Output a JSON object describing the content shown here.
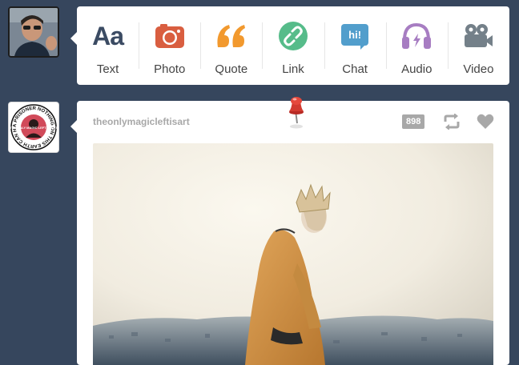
{
  "post_types": [
    {
      "label": "Text",
      "icon": "text-icon",
      "glyph": "Aa",
      "color": "#3b4b63"
    },
    {
      "label": "Photo",
      "icon": "camera-icon",
      "color": "#d95e40"
    },
    {
      "label": "Quote",
      "icon": "quote-icon",
      "color": "#f2992e"
    },
    {
      "label": "Link",
      "icon": "link-icon",
      "color": "#56bc8a"
    },
    {
      "label": "Chat",
      "icon": "chat-icon",
      "glyph": "hi!",
      "color": "#529ecc"
    },
    {
      "label": "Audio",
      "icon": "headphones-icon",
      "color": "#a77dc2"
    },
    {
      "label": "Video",
      "icon": "video-camera-icon",
      "color": "#748089"
    }
  ],
  "post": {
    "author": "theonlymagicleftisart",
    "notes": "898",
    "photo_subject": "figure-with-crown"
  },
  "blog_avatar": {
    "ring_text": "A PRISONER NOTHING ON THIS EARTH CAN HOLD",
    "center_text": "THE ONLY MAGIC LEFT IS ART"
  }
}
